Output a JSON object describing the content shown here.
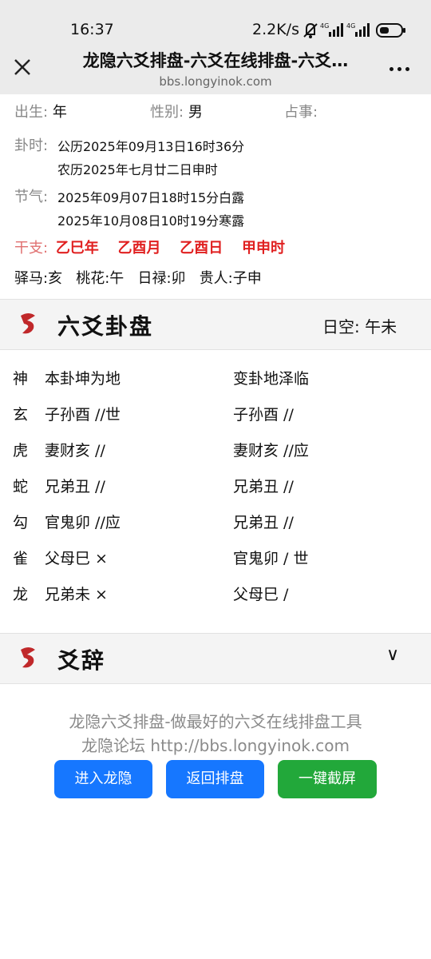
{
  "status": {
    "time": "16:37",
    "speed": "2.2K/s",
    "net1": "4G",
    "net2": "4G"
  },
  "header": {
    "title": "龙隐六爻排盘-六爻在线排盘-六爻…",
    "url": "bbs.longyinok.com"
  },
  "info": {
    "birth_label": "出生:",
    "birth_value": "年",
    "gender_label": "性别:",
    "gender_value": "男",
    "matter_label": "占事:",
    "time_label": "卦时:",
    "time_solar": "公历2025年09月13日16时36分",
    "time_lunar": "农历2025年七月廿二日申时",
    "term_label": "节气:",
    "term1": "2025年09月07日18时15分白露",
    "term2": "2025年10月08日10时19分寒露",
    "ganzhi_label": "干支:",
    "ganzhi": [
      "乙巳年",
      "乙酉月",
      "乙酉日",
      "甲申时"
    ],
    "shensha": "驿马:亥   桃花:午   日禄:卯   贵人:子申"
  },
  "gua_section": {
    "title": "六爻卦盘",
    "kong": "日空: 午未"
  },
  "gua_rows": [
    {
      "god": "神",
      "ben": "本卦坤为地",
      "bian": "变卦地泽临"
    },
    {
      "god": "玄",
      "ben": "子孙酉 //世",
      "bian": "子孙酉 //"
    },
    {
      "god": "虎",
      "ben": "妻财亥 //",
      "bian": "妻财亥 //应"
    },
    {
      "god": "蛇",
      "ben": "兄弟丑 //",
      "bian": "兄弟丑 //"
    },
    {
      "god": "勾",
      "ben": "官鬼卯 //应",
      "bian": "兄弟丑 //"
    },
    {
      "god": "雀",
      "ben": "父母巳 ×",
      "bian": "官鬼卯 / 世"
    },
    {
      "god": "龙",
      "ben": "兄弟未 ×",
      "bian": "父母巳 /"
    }
  ],
  "yaoci_section": {
    "title": "爻辞",
    "chevron": "∨"
  },
  "footer": {
    "line1": "龙隐六爻排盘-做最好的六爻在线排盘工具",
    "line2": "龙隐论坛 http://bbs.longyinok.com"
  },
  "buttons": {
    "enter": "进入龙隐",
    "back": "返回排盘",
    "screenshot": "一键截屏"
  },
  "colors": {
    "blue": "#1677ff",
    "green": "#22a83a",
    "red": "#e02020"
  },
  "icons": [
    "close-icon",
    "more-icon",
    "dragon-logo-icon",
    "chevron-down-icon",
    "signal-icon",
    "battery-icon",
    "mute-bell-icon"
  ]
}
